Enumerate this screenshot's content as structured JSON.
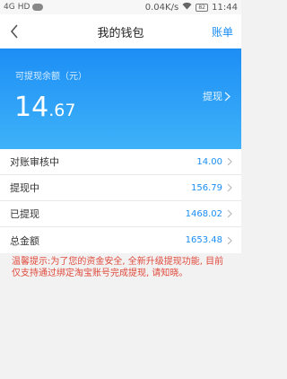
{
  "status_bar": {
    "network": "4G",
    "hd": "HD",
    "speed": "0.04K/s",
    "battery": "82",
    "time": "11:44"
  },
  "header": {
    "title": "我的钱包",
    "bill_label": "账单",
    "back_icon": "chevron-left-icon"
  },
  "balance": {
    "label": "可提现余额（元）",
    "amount_int": "14",
    "amount_dec": ".67",
    "withdraw_label": "提现"
  },
  "rows": [
    {
      "label": "对账审核中",
      "value": "14.00"
    },
    {
      "label": "提现中",
      "value": "156.79"
    },
    {
      "label": "已提现",
      "value": "1468.02"
    },
    {
      "label": "总金额",
      "value": "1653.48"
    }
  ],
  "notice": "温馨提示:为了您的资金安全, 全新升级提现功能, 目前仅支持通过绑定淘宝账号完成提现, 请知晓。",
  "colors": {
    "accent": "#1a8df5",
    "card_top": "#1c8ef6",
    "card_bottom": "#3fb2f8",
    "notice": "#e04a3c"
  }
}
